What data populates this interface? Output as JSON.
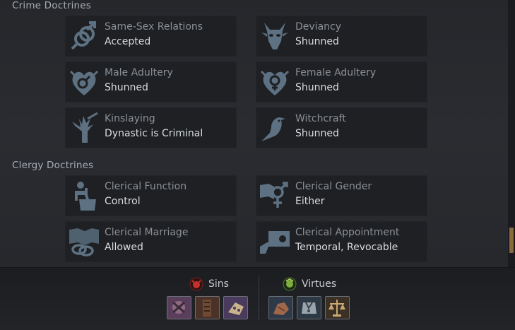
{
  "sections": {
    "crime": "Crime Doctrines",
    "clergy": "Clergy Doctrines"
  },
  "doctrines": [
    {
      "label": "Same-Sex Relations",
      "value": "Accepted",
      "icon": "gender-symbols-icon"
    },
    {
      "label": "Deviancy",
      "value": "Shunned",
      "icon": "goat-head-icon"
    },
    {
      "label": "Male Adultery",
      "value": "Shunned",
      "icon": "male-heart-icon"
    },
    {
      "label": "Female Adultery",
      "value": "Shunned",
      "icon": "female-heart-icon"
    },
    {
      "label": "Kinslaying",
      "value": "Dynastic is Criminal",
      "icon": "broken-tree-icon"
    },
    {
      "label": "Witchcraft",
      "value": "Shunned",
      "icon": "raven-icon"
    },
    {
      "label": "Clerical Function",
      "value": "Control",
      "icon": "cleric-podium-icon"
    },
    {
      "label": "Clerical Gender",
      "value": "Either",
      "icon": "book-gender-icon"
    },
    {
      "label": "Clerical Marriage",
      "value": "Allowed",
      "icon": "book-rings-icon"
    },
    {
      "label": "Clerical Appointment",
      "value": "Temporal, Revocable",
      "icon": "appointment-icon"
    }
  ],
  "sins": {
    "label": "Sins",
    "icon": "sins-icon",
    "traits": [
      "sin-trait-1-icon",
      "sin-trait-2-icon",
      "sin-trait-3-icon"
    ]
  },
  "virtues": {
    "label": "Virtues",
    "icon": "virtues-icon",
    "traits": [
      "virtue-trait-1-icon",
      "virtue-trait-2-icon",
      "virtue-trait-3-icon"
    ]
  },
  "colors": {
    "accent": "#8a6a3c",
    "label": "#8b9097",
    "value": "#d9dce0",
    "icon": "#5d7182"
  }
}
